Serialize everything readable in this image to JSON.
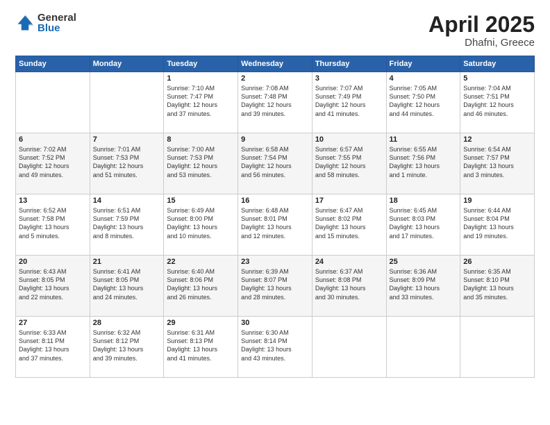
{
  "logo": {
    "general": "General",
    "blue": "Blue"
  },
  "title": "April 2025",
  "subtitle": "Dhafni, Greece",
  "days_of_week": [
    "Sunday",
    "Monday",
    "Tuesday",
    "Wednesday",
    "Thursday",
    "Friday",
    "Saturday"
  ],
  "weeks": [
    [
      {
        "day": null,
        "content": null
      },
      {
        "day": null,
        "content": null
      },
      {
        "day": "1",
        "content": "Sunrise: 7:10 AM\nSunset: 7:47 PM\nDaylight: 12 hours\nand 37 minutes."
      },
      {
        "day": "2",
        "content": "Sunrise: 7:08 AM\nSunset: 7:48 PM\nDaylight: 12 hours\nand 39 minutes."
      },
      {
        "day": "3",
        "content": "Sunrise: 7:07 AM\nSunset: 7:49 PM\nDaylight: 12 hours\nand 41 minutes."
      },
      {
        "day": "4",
        "content": "Sunrise: 7:05 AM\nSunset: 7:50 PM\nDaylight: 12 hours\nand 44 minutes."
      },
      {
        "day": "5",
        "content": "Sunrise: 7:04 AM\nSunset: 7:51 PM\nDaylight: 12 hours\nand 46 minutes."
      }
    ],
    [
      {
        "day": "6",
        "content": "Sunrise: 7:02 AM\nSunset: 7:52 PM\nDaylight: 12 hours\nand 49 minutes."
      },
      {
        "day": "7",
        "content": "Sunrise: 7:01 AM\nSunset: 7:53 PM\nDaylight: 12 hours\nand 51 minutes."
      },
      {
        "day": "8",
        "content": "Sunrise: 7:00 AM\nSunset: 7:53 PM\nDaylight: 12 hours\nand 53 minutes."
      },
      {
        "day": "9",
        "content": "Sunrise: 6:58 AM\nSunset: 7:54 PM\nDaylight: 12 hours\nand 56 minutes."
      },
      {
        "day": "10",
        "content": "Sunrise: 6:57 AM\nSunset: 7:55 PM\nDaylight: 12 hours\nand 58 minutes."
      },
      {
        "day": "11",
        "content": "Sunrise: 6:55 AM\nSunset: 7:56 PM\nDaylight: 13 hours\nand 1 minute."
      },
      {
        "day": "12",
        "content": "Sunrise: 6:54 AM\nSunset: 7:57 PM\nDaylight: 13 hours\nand 3 minutes."
      }
    ],
    [
      {
        "day": "13",
        "content": "Sunrise: 6:52 AM\nSunset: 7:58 PM\nDaylight: 13 hours\nand 5 minutes."
      },
      {
        "day": "14",
        "content": "Sunrise: 6:51 AM\nSunset: 7:59 PM\nDaylight: 13 hours\nand 8 minutes."
      },
      {
        "day": "15",
        "content": "Sunrise: 6:49 AM\nSunset: 8:00 PM\nDaylight: 13 hours\nand 10 minutes."
      },
      {
        "day": "16",
        "content": "Sunrise: 6:48 AM\nSunset: 8:01 PM\nDaylight: 13 hours\nand 12 minutes."
      },
      {
        "day": "17",
        "content": "Sunrise: 6:47 AM\nSunset: 8:02 PM\nDaylight: 13 hours\nand 15 minutes."
      },
      {
        "day": "18",
        "content": "Sunrise: 6:45 AM\nSunset: 8:03 PM\nDaylight: 13 hours\nand 17 minutes."
      },
      {
        "day": "19",
        "content": "Sunrise: 6:44 AM\nSunset: 8:04 PM\nDaylight: 13 hours\nand 19 minutes."
      }
    ],
    [
      {
        "day": "20",
        "content": "Sunrise: 6:43 AM\nSunset: 8:05 PM\nDaylight: 13 hours\nand 22 minutes."
      },
      {
        "day": "21",
        "content": "Sunrise: 6:41 AM\nSunset: 8:05 PM\nDaylight: 13 hours\nand 24 minutes."
      },
      {
        "day": "22",
        "content": "Sunrise: 6:40 AM\nSunset: 8:06 PM\nDaylight: 13 hours\nand 26 minutes."
      },
      {
        "day": "23",
        "content": "Sunrise: 6:39 AM\nSunset: 8:07 PM\nDaylight: 13 hours\nand 28 minutes."
      },
      {
        "day": "24",
        "content": "Sunrise: 6:37 AM\nSunset: 8:08 PM\nDaylight: 13 hours\nand 30 minutes."
      },
      {
        "day": "25",
        "content": "Sunrise: 6:36 AM\nSunset: 8:09 PM\nDaylight: 13 hours\nand 33 minutes."
      },
      {
        "day": "26",
        "content": "Sunrise: 6:35 AM\nSunset: 8:10 PM\nDaylight: 13 hours\nand 35 minutes."
      }
    ],
    [
      {
        "day": "27",
        "content": "Sunrise: 6:33 AM\nSunset: 8:11 PM\nDaylight: 13 hours\nand 37 minutes."
      },
      {
        "day": "28",
        "content": "Sunrise: 6:32 AM\nSunset: 8:12 PM\nDaylight: 13 hours\nand 39 minutes."
      },
      {
        "day": "29",
        "content": "Sunrise: 6:31 AM\nSunset: 8:13 PM\nDaylight: 13 hours\nand 41 minutes."
      },
      {
        "day": "30",
        "content": "Sunrise: 6:30 AM\nSunset: 8:14 PM\nDaylight: 13 hours\nand 43 minutes."
      },
      {
        "day": null,
        "content": null
      },
      {
        "day": null,
        "content": null
      },
      {
        "day": null,
        "content": null
      }
    ]
  ]
}
